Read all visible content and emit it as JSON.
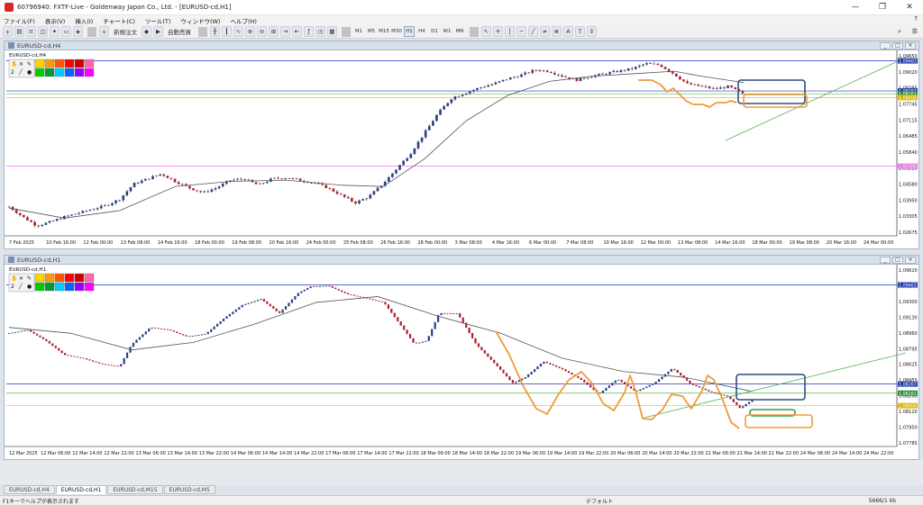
{
  "window": {
    "title": "60796940: FXTF-Live - Goldenway Japan Co., Ltd. - [EURUSD-cd,H1]",
    "controls": [
      "—",
      "❐",
      "✕"
    ]
  },
  "menu": {
    "items": [
      "ファイル(F)",
      "表示(V)",
      "挿入(I)",
      "チャート(C)",
      "ツール(T)",
      "ウィンドウ(W)",
      "ヘルプ(H)"
    ],
    "help_icon": "?"
  },
  "toolbar": {
    "new_order": "新規注文",
    "auto_trade": "自動売買",
    "timeframes": [
      "M1",
      "M5",
      "M15",
      "M30",
      "H1",
      "H4",
      "D1",
      "W1",
      "MN"
    ],
    "active_timeframe": "H1"
  },
  "chart_top": {
    "window_title": "EURUSD-cd,H4",
    "inner_label": "EURUSD-cd,H4",
    "chart_data": {
      "type": "candlestick",
      "symbol": "EURUSD-cd",
      "timeframe": "H4",
      "ylim": [
        1.0255,
        1.0973
      ],
      "y_ticks": [
        "1.09650",
        "1.09020",
        "1.08385",
        "1.07745",
        "1.07115",
        "1.06485",
        "1.05840",
        "1.05210",
        "1.04580",
        "1.03950",
        "1.03305",
        "1.02675"
      ],
      "x_ticks": [
        "7 Feb 2025",
        "10 Feb 16:00",
        "12 Feb 00:00",
        "13 Feb 08:00",
        "14 Feb 16:00",
        "18 Feb 00:00",
        "19 Feb 08:00",
        "20 Feb 16:00",
        "24 Feb 00:00",
        "25 Feb 08:00",
        "26 Feb 16:00",
        "28 Feb 00:00",
        "3 Mar 08:00",
        "4 Mar 16:00",
        "6 Mar 00:00",
        "7 Mar 08:00",
        "10 Mar 16:00",
        "12 Mar 00:00",
        "13 Mar 08:00",
        "14 Mar 16:00",
        "18 Mar 00:00",
        "19 Mar 08:00",
        "20 Mar 16:00",
        "24 Mar 00:00"
      ],
      "price_labels": [
        {
          "value": 1.0946,
          "text": "1.09463",
          "color": "#1f3aa8"
        },
        {
          "value": 1.0827,
          "text": "1.08267",
          "color": "#1f3aa8"
        },
        {
          "value": 1.0816,
          "text": "1.08161",
          "color": "#2c8c3a"
        },
        {
          "value": 1.0801,
          "text": "1.08008",
          "color": "#d9b300"
        },
        {
          "value": 1.053,
          "text": "1.05305",
          "color": "#e078e0"
        }
      ],
      "path_points": [
        [
          0,
          1.037
        ],
        [
          2,
          1.033
        ],
        [
          4,
          1.0295
        ],
        [
          6,
          1.031
        ],
        [
          8,
          1.033
        ],
        [
          10,
          1.0345
        ],
        [
          12,
          1.036
        ],
        [
          14,
          1.0375
        ],
        [
          16,
          1.04
        ],
        [
          18,
          1.046
        ],
        [
          20,
          1.048
        ],
        [
          22,
          1.05
        ],
        [
          24,
          1.047
        ],
        [
          26,
          1.0445
        ],
        [
          28,
          1.0425
        ],
        [
          30,
          1.0445
        ],
        [
          32,
          1.0475
        ],
        [
          34,
          1.048
        ],
        [
          36,
          1.0455
        ],
        [
          38,
          1.048
        ],
        [
          40,
          1.0485
        ],
        [
          42,
          1.0475
        ],
        [
          44,
          1.0465
        ],
        [
          46,
          1.0445
        ],
        [
          48,
          1.0415
        ],
        [
          50,
          1.0385
        ],
        [
          52,
          1.041
        ],
        [
          54,
          1.046
        ],
        [
          56,
          1.052
        ],
        [
          58,
          1.058
        ],
        [
          60,
          1.066
        ],
        [
          62,
          1.074
        ],
        [
          64,
          1.08
        ],
        [
          66,
          1.082
        ],
        [
          68,
          1.084
        ],
        [
          70,
          1.0855
        ],
        [
          72,
          1.0875
        ],
        [
          74,
          1.089
        ],
        [
          76,
          1.091
        ],
        [
          78,
          1.0905
        ],
        [
          80,
          1.0885
        ],
        [
          82,
          1.087
        ],
        [
          84,
          1.0885
        ],
        [
          86,
          1.0895
        ],
        [
          88,
          1.0905
        ],
        [
          90,
          1.0915
        ],
        [
          92,
          1.0935
        ],
        [
          94,
          1.093
        ],
        [
          96,
          1.0895
        ],
        [
          98,
          1.0855
        ],
        [
          100,
          1.0845
        ],
        [
          102,
          1.0835
        ],
        [
          104,
          1.0845
        ],
        [
          106,
          1.0815
        ]
      ],
      "ma_points": [
        [
          0,
          1.0365
        ],
        [
          8,
          1.0325
        ],
        [
          16,
          1.0355
        ],
        [
          24,
          1.045
        ],
        [
          32,
          1.047
        ],
        [
          40,
          1.0475
        ],
        [
          48,
          1.0455
        ],
        [
          54,
          1.045
        ],
        [
          60,
          1.056
        ],
        [
          66,
          1.071
        ],
        [
          72,
          1.081
        ],
        [
          78,
          1.0865
        ],
        [
          84,
          1.0885
        ],
        [
          90,
          1.0895
        ],
        [
          96,
          1.0905
        ],
        [
          100,
          1.0885
        ],
        [
          106,
          1.086
        ]
      ]
    }
  },
  "chart_bottom": {
    "window_title": "EURUSD-cd,H1",
    "inner_label": "EURUSD-cd,H1",
    "chart_data": {
      "type": "candlestick",
      "symbol": "EURUSD-cd",
      "timeframe": "H1",
      "ylim": [
        1.0752,
        1.0966
      ],
      "y_ticks": [
        "1.09620",
        "1.09465",
        "1.09300",
        "1.09130",
        "1.08960",
        "1.08795",
        "1.08625",
        "1.08455",
        "1.08290",
        "1.08120",
        "1.07950",
        "1.07785"
      ],
      "x_ticks": [
        "12 Mar 2025",
        "12 Mar 06:00",
        "12 Mar 14:00",
        "12 Mar 22:00",
        "13 Mar 06:00",
        "13 Mar 14:00",
        "13 Mar 22:00",
        "14 Mar 06:00",
        "14 Mar 14:00",
        "14 Mar 22:00",
        "17 Mar 06:00",
        "17 Mar 14:00",
        "17 Mar 22:00",
        "18 Mar 06:00",
        "18 Mar 14:00",
        "18 Mar 22:00",
        "19 Mar 06:00",
        "19 Mar 14:00",
        "19 Mar 22:00",
        "20 Mar 06:00",
        "20 Mar 14:00",
        "20 Mar 22:00",
        "21 Mar 06:00",
        "21 Mar 14:00",
        "21 Mar 22:00",
        "24 Mar 06:00",
        "24 Mar 14:00",
        "24 Mar 22:00"
      ],
      "price_labels": [
        {
          "value": 1.0946,
          "text": "1.09463",
          "color": "#1f3aa8"
        },
        {
          "value": 1.0827,
          "text": "1.08267",
          "color": "#1f3aa8"
        },
        {
          "value": 1.0816,
          "text": "1.08161",
          "color": "#2c8c3a"
        },
        {
          "value": 1.0801,
          "text": "1.08008",
          "color": "#d9b300"
        }
      ],
      "path_points": [
        [
          0,
          1.0888
        ],
        [
          6,
          1.0892
        ],
        [
          12,
          1.0879
        ],
        [
          18,
          1.0862
        ],
        [
          24,
          1.0858
        ],
        [
          30,
          1.0851
        ],
        [
          36,
          1.0848
        ],
        [
          40,
          1.0875
        ],
        [
          46,
          1.0895
        ],
        [
          52,
          1.0892
        ],
        [
          58,
          1.0884
        ],
        [
          64,
          1.0887
        ],
        [
          70,
          1.0906
        ],
        [
          76,
          1.0922
        ],
        [
          82,
          1.0929
        ],
        [
          88,
          1.0912
        ],
        [
          94,
          1.0936
        ],
        [
          98,
          1.0944
        ],
        [
          104,
          1.0945
        ],
        [
          110,
          1.0935
        ],
        [
          116,
          1.093
        ],
        [
          122,
          1.0925
        ],
        [
          128,
          1.0895
        ],
        [
          132,
          1.0875
        ],
        [
          136,
          1.0879
        ],
        [
          140,
          1.0912
        ],
        [
          146,
          1.0912
        ],
        [
          152,
          1.0875
        ],
        [
          158,
          1.0852
        ],
        [
          164,
          1.0828
        ],
        [
          168,
          1.0835
        ],
        [
          174,
          1.0854
        ],
        [
          180,
          1.0845
        ],
        [
          186,
          1.0833
        ],
        [
          192,
          1.0815
        ],
        [
          198,
          1.0833
        ],
        [
          204,
          1.0818
        ],
        [
          210,
          1.0828
        ],
        [
          216,
          1.0846
        ],
        [
          222,
          1.0827
        ],
        [
          228,
          1.0818
        ],
        [
          234,
          1.0812
        ],
        [
          238,
          1.0798
        ],
        [
          242,
          1.0808
        ]
      ],
      "ma_points": [
        [
          0,
          1.0895
        ],
        [
          20,
          1.0888
        ],
        [
          40,
          1.0868
        ],
        [
          60,
          1.0877
        ],
        [
          80,
          1.0899
        ],
        [
          100,
          1.0925
        ],
        [
          120,
          1.0932
        ],
        [
          140,
          1.0908
        ],
        [
          160,
          1.0888
        ],
        [
          180,
          1.0858
        ],
        [
          200,
          1.0842
        ],
        [
          220,
          1.0835
        ],
        [
          242,
          1.0818
        ]
      ]
    }
  },
  "tabs": [
    "EURUSD-cd,H4",
    "EURUSD-cd,H1",
    "EURUSD-cd,M15",
    "EURUSD-cd,M5"
  ],
  "active_tab": "EURUSD-cd,H1",
  "status": {
    "help_hint": "F1キーでヘルプが表示されます",
    "profile": "デフォルト",
    "connection": "5666/1 kb"
  },
  "colors": {
    "bull": "#ffffff",
    "bear": "#b22222",
    "bull_body": "#2a3f85",
    "bear_body": "#b01c2e",
    "grid": "#ffffff",
    "ma": "#555555",
    "blue_line": "#2233cc",
    "trend_line": "#56b356",
    "orange": "#f09a3a",
    "rect_blue": "#2f4d7c",
    "rect_green": "#2da24b",
    "magenta": "#ff66ff"
  }
}
